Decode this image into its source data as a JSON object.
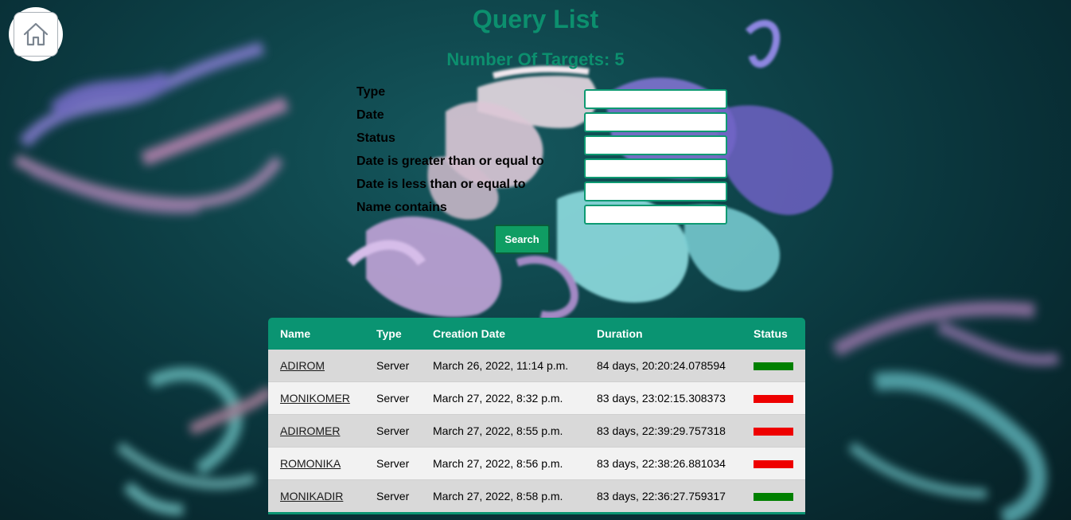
{
  "page": {
    "title": "Query List",
    "target_count_label": "Number Of Targets: 5"
  },
  "home": {
    "icon": "home-icon"
  },
  "filters": {
    "fields": [
      {
        "key": "type",
        "label": "Type",
        "value": ""
      },
      {
        "key": "date",
        "label": "Date",
        "value": ""
      },
      {
        "key": "status",
        "label": "Status",
        "value": ""
      },
      {
        "key": "date_gte",
        "label": "Date is greater than or equal to",
        "value": ""
      },
      {
        "key": "date_lte",
        "label": "Date is less than or equal to",
        "value": ""
      },
      {
        "key": "name_contains",
        "label": "Name contains",
        "value": ""
      }
    ],
    "search_label": "Search"
  },
  "table": {
    "headers": [
      "Name",
      "Type",
      "Creation Date",
      "Duration",
      "Status"
    ],
    "rows": [
      {
        "name": "ADIROM",
        "type": "Server",
        "creation_date": "March 26, 2022, 11:14 p.m.",
        "duration": "84 days, 20:20:24.078594",
        "status": "green"
      },
      {
        "name": "MONIKOMER",
        "type": "Server",
        "creation_date": "March 27, 2022, 8:32 p.m.",
        "duration": "83 days, 23:02:15.308373",
        "status": "red"
      },
      {
        "name": "ADIROMER",
        "type": "Server",
        "creation_date": "March 27, 2022, 8:55 p.m.",
        "duration": "83 days, 22:39:29.757318",
        "status": "red"
      },
      {
        "name": "ROMONIKA",
        "type": "Server",
        "creation_date": "March 27, 2022, 8:56 p.m.",
        "duration": "83 days, 22:38:26.881034",
        "status": "red"
      },
      {
        "name": "MONIKADIR",
        "type": "Server",
        "creation_date": "March 27, 2022, 8:58 p.m.",
        "duration": "83 days, 22:36:27.759317",
        "status": "green"
      }
    ]
  },
  "colors": {
    "accent": "#0a9472",
    "title": "#0c8f6e",
    "status_green": "#008000",
    "status_red": "#ee0000",
    "search_button": "#0f9d63"
  }
}
